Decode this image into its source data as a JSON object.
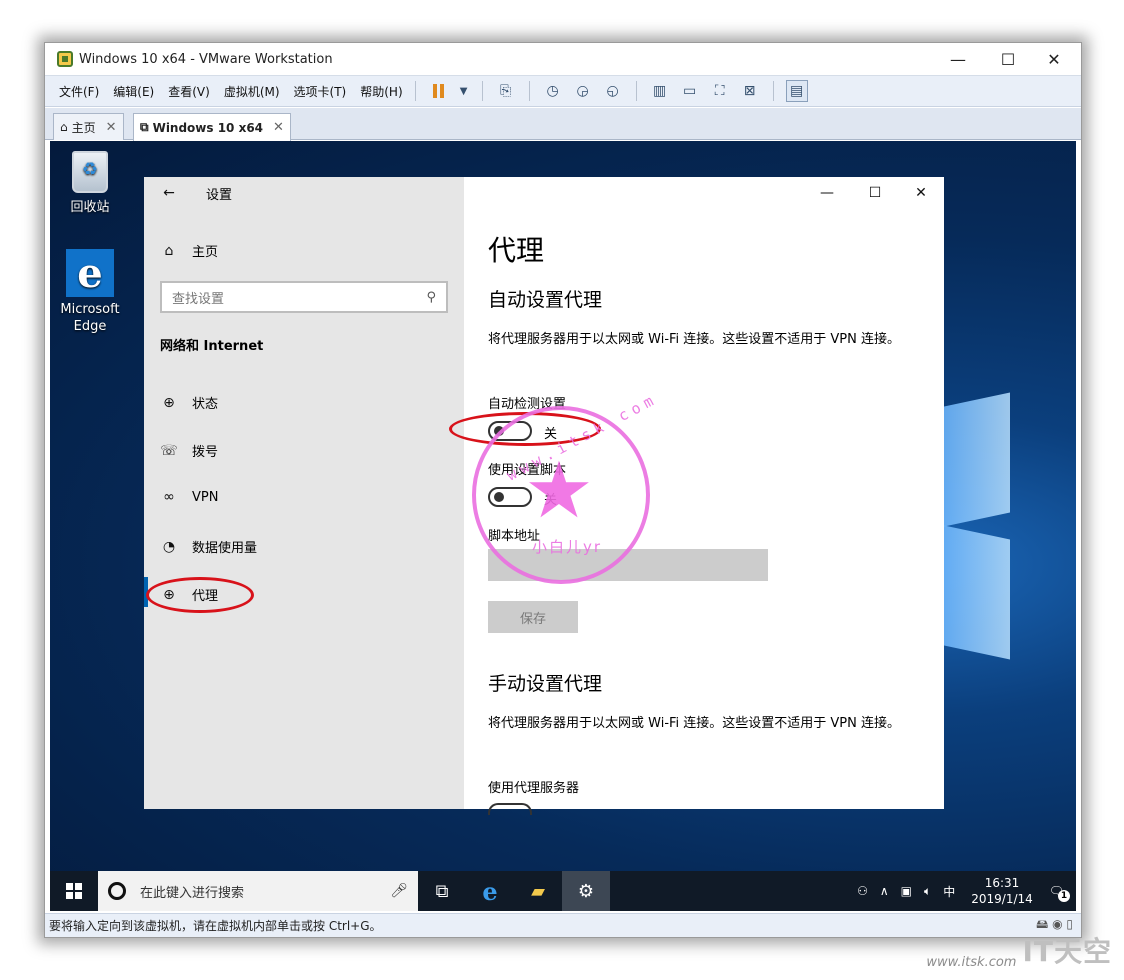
{
  "window": {
    "title": "Windows 10 x64 - VMware Workstation",
    "min_glyph": "—",
    "max_glyph": "☐",
    "close_glyph": "✕"
  },
  "menu": {
    "items": [
      "文件(F)",
      "编辑(E)",
      "查看(V)",
      "虚拟机(M)",
      "选项卡(T)",
      "帮助(H)"
    ]
  },
  "tabs": [
    {
      "label": "主页",
      "close": "✕"
    },
    {
      "label": "Windows 10 x64",
      "close": "✕"
    }
  ],
  "desktop": {
    "recycle_bin": "回收站",
    "edge_line1": "Microsoft",
    "edge_line2": "Edge",
    "edge_glyph": "e"
  },
  "settings": {
    "back_glyph": "←",
    "title": "设置",
    "home": "主页",
    "search_placeholder": "查找设置",
    "section": "网络和 Internet",
    "nav": [
      "状态",
      "拨号",
      "VPN",
      "数据使用量",
      "代理"
    ],
    "page_title": "代理",
    "auto_header": "自动设置代理",
    "auto_desc": "将代理服务器用于以太网或 Wi-Fi 连接。这些设置不适用于 VPN 连接。",
    "auto_detect_label": "自动检测设置",
    "auto_detect_state": "关",
    "use_script_label": "使用设置脚本",
    "use_script_state": "关",
    "script_addr_label": "脚本地址",
    "save": "保存",
    "manual_header": "手动设置代理",
    "manual_desc": "将代理服务器用于以太网或 Wi-Fi 连接。这些设置不适用于 VPN 连接。",
    "use_proxy_label": "使用代理服务器",
    "min_glyph": "—",
    "max_glyph": "☐",
    "close_glyph": "✕"
  },
  "taskbar": {
    "search_placeholder": "在此键入进行搜索",
    "ime": "中",
    "time": "16:31",
    "date": "2019/1/14",
    "notification_count": "1"
  },
  "statusbar": {
    "text": "要将输入定向到该虚拟机，请在虚拟机内部单击或按 Ctrl+G。"
  },
  "stamp": {
    "ring_text": "www.itsk.com",
    "sub_text": "小白儿yr"
  },
  "watermark": {
    "url": "www.itsk.com",
    "brand": "IT天空"
  },
  "colors": {
    "accent": "#0063b1",
    "annotation": "#d8121a",
    "stamp": "#ea6fe0",
    "pause": "#e08a1e"
  }
}
